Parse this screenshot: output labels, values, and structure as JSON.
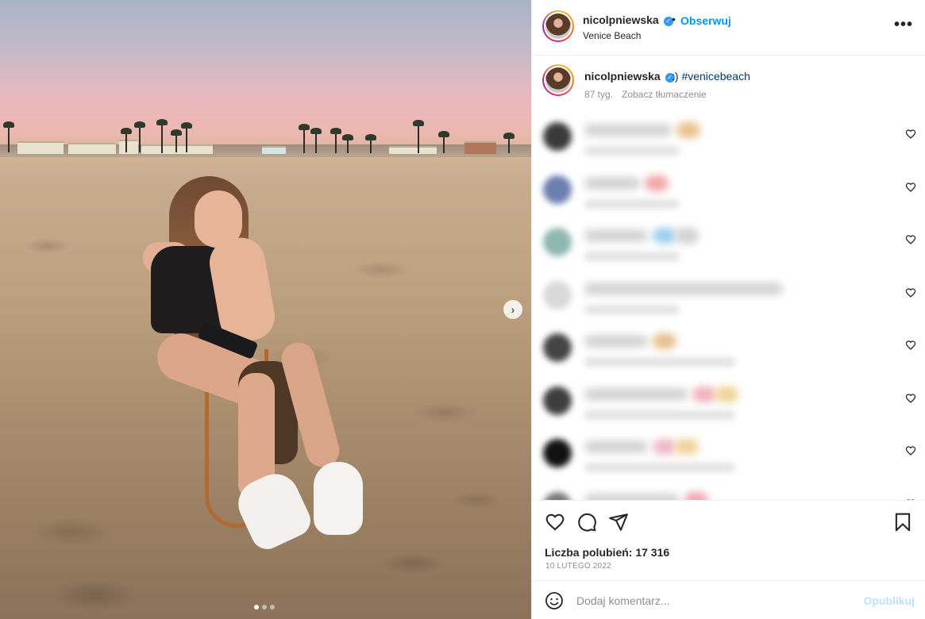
{
  "post": {
    "username": "nicolpniewska",
    "verified": true,
    "follow_label": "Obserwuj",
    "separator": "•",
    "location": "Venice Beach",
    "more_label": "•••"
  },
  "caption": {
    "username": "nicolpniewska",
    "text": ":)",
    "hashtag": "#venicebeach",
    "time_ago": "87 tyg.",
    "translate_label": "Zobacz tłumaczenie"
  },
  "carousel": {
    "next_label": "›",
    "slide_count": 3,
    "active_slide": 1
  },
  "comments": {
    "blurred": true,
    "count_visible": 8
  },
  "actions": {
    "like_icon": "heart-icon",
    "comment_icon": "comment-icon",
    "share_icon": "share-icon",
    "save_icon": "bookmark-icon"
  },
  "stats": {
    "likes_text": "Liczba polubień: 17 316",
    "date_text": "10 LUTEGO 2022"
  },
  "add_comment": {
    "placeholder": "Dodaj komentarz...",
    "publish_label": "Opublikuj",
    "emoji_icon": "emoji-smile-icon"
  },
  "colors": {
    "accent": "#0095f6",
    "verified": "#3897f0",
    "publish_disabled": "#c0dffd",
    "muted": "#8e8e8e"
  }
}
